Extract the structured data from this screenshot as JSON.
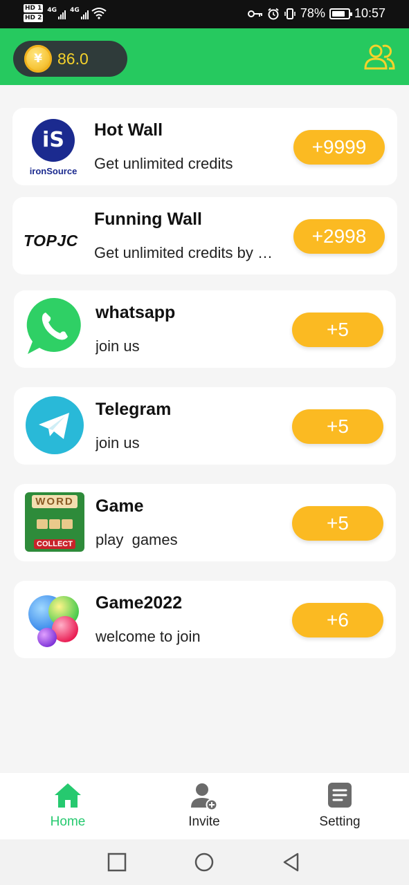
{
  "status_bar": {
    "hd1": "HD 1",
    "hd2": "HD 2",
    "net1": "4G",
    "net2": "4G",
    "battery": "78%",
    "time": "10:57"
  },
  "header": {
    "coin_symbol": "¥",
    "balance": "86.0",
    "profile_icon": "users-icon"
  },
  "cards": [
    {
      "title": "Hot Wall",
      "desc": "Get unlimited credits",
      "reward": "+9999",
      "logo": "ironsource-logo",
      "logo_text": "iS",
      "logo_caption": "ironSource"
    },
    {
      "title": "Funning Wall",
      "desc": "Get unlimited credits by doing tasks",
      "reward": "+2998",
      "logo": "topjoy-logo",
      "logo_text": "TOPJC"
    },
    {
      "title": "whatsapp",
      "desc": "join us",
      "reward": "+5",
      "logo": "whatsapp-logo"
    },
    {
      "title": "Telegram",
      "desc": "join us",
      "reward": "+5",
      "logo": "telegram-logo"
    },
    {
      "title": "Game",
      "desc": "play  games",
      "reward": "+5",
      "logo": "word-collect-logo",
      "logo_text_top": "WORD",
      "logo_text_bottom": "COLLECT"
    },
    {
      "title": "Game2022",
      "desc": "welcome to join",
      "reward": "+6",
      "logo": "game-center-logo"
    }
  ],
  "bottom_nav": [
    {
      "label": "Home",
      "icon": "home-icon",
      "active": true
    },
    {
      "label": "Invite",
      "icon": "add-user-icon",
      "active": false
    },
    {
      "label": "Setting",
      "icon": "document-icon",
      "active": false
    }
  ],
  "colors": {
    "header_green": "#26c95f",
    "reward_orange": "#fbba22",
    "active_green": "#26c96f",
    "coin_text": "#f5d22c"
  }
}
